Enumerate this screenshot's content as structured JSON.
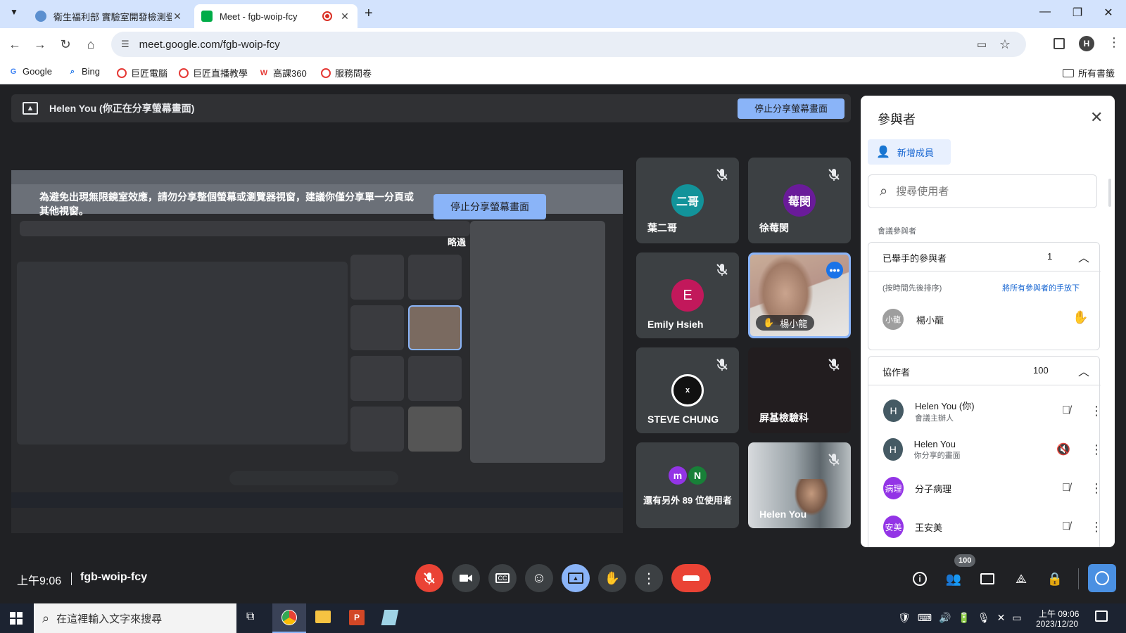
{
  "browser": {
    "tabs": [
      {
        "title": "衛生福利部 實驗室開發檢測登錄",
        "active": false
      },
      {
        "title": "Meet - fgb-woip-fcy",
        "active": true
      }
    ],
    "new_tab": "+",
    "url": "meet.google.com/fgb-woip-fcy",
    "profile_initial": "H",
    "bookmarks": [
      "Google",
      "Bing",
      "巨匠電腦",
      "巨匠直播教學",
      "高課360",
      "服務問卷"
    ],
    "all_bookmarks": "所有書籤"
  },
  "meet": {
    "share_banner": "Helen You (你正在分享螢幕畫面)",
    "stop_share": "停止分享螢幕畫面",
    "warning": "為避免出現無限鏡室效應，請勿分享整個螢幕或瀏覽器視窗，建議你僅分享單一分頁或其他視窗。",
    "preview_stop": "停止分享螢幕畫面",
    "skip": "略過",
    "tiles": [
      {
        "name": "葉二哥",
        "avatar": "二哥",
        "color": "#12939a",
        "muted": true
      },
      {
        "name": "徐莓閔",
        "avatar": "莓閔",
        "color": "#6a1b9a",
        "muted": true
      },
      {
        "name": "Emily Hsieh",
        "avatar": "E",
        "color": "#c2185b",
        "muted": true
      },
      {
        "name": "楊小龍",
        "avatar": "",
        "color": "",
        "muted": false,
        "hand": true
      },
      {
        "name": "STEVE CHUNG",
        "avatar": "x",
        "color": "#111",
        "muted": true
      },
      {
        "name": "屏基檢驗科",
        "avatar": "",
        "color": "",
        "muted": true
      },
      {
        "name": "還有另外 89 位使用者",
        "avatar": "",
        "color": "",
        "muted": false
      },
      {
        "name": "Helen You",
        "avatar": "",
        "color": "",
        "muted": true
      }
    ],
    "others_avatars": [
      {
        "l": "m",
        "c": "#9334e6"
      },
      {
        "l": "N",
        "c": "#188038"
      }
    ],
    "time": "上午9:06",
    "code": "fgb-woip-fcy",
    "people_count": "100"
  },
  "panel": {
    "title": "參與者",
    "add": "新增成員",
    "search_placeholder": "搜尋使用者",
    "section_label": "會議參與者",
    "raised": {
      "label": "已舉手的參與者",
      "count": "1",
      "order": "(按時間先後排序)",
      "lower_all": "將所有參與者的手放下",
      "person": {
        "name": "楊小龍",
        "avatar": "小龍",
        "color": "#9e9e9e"
      }
    },
    "collab": {
      "label": "協作者",
      "count": "100"
    },
    "people": [
      {
        "name": "Helen You (你)",
        "sub": "會議主辦人",
        "avatar": "H",
        "color": "#455a64"
      },
      {
        "name": "Helen You",
        "sub": "你分享的畫面",
        "avatar": "H",
        "color": "#455a64"
      },
      {
        "name": "分子病理",
        "sub": "",
        "avatar": "病理",
        "color": "#9334e6"
      },
      {
        "name": "王安美",
        "sub": "",
        "avatar": "安美",
        "color": "#9334e6"
      }
    ]
  },
  "taskbar": {
    "search": "在這裡輸入文字來搜尋",
    "time": "上午 09:06",
    "date": "2023/12/20"
  }
}
